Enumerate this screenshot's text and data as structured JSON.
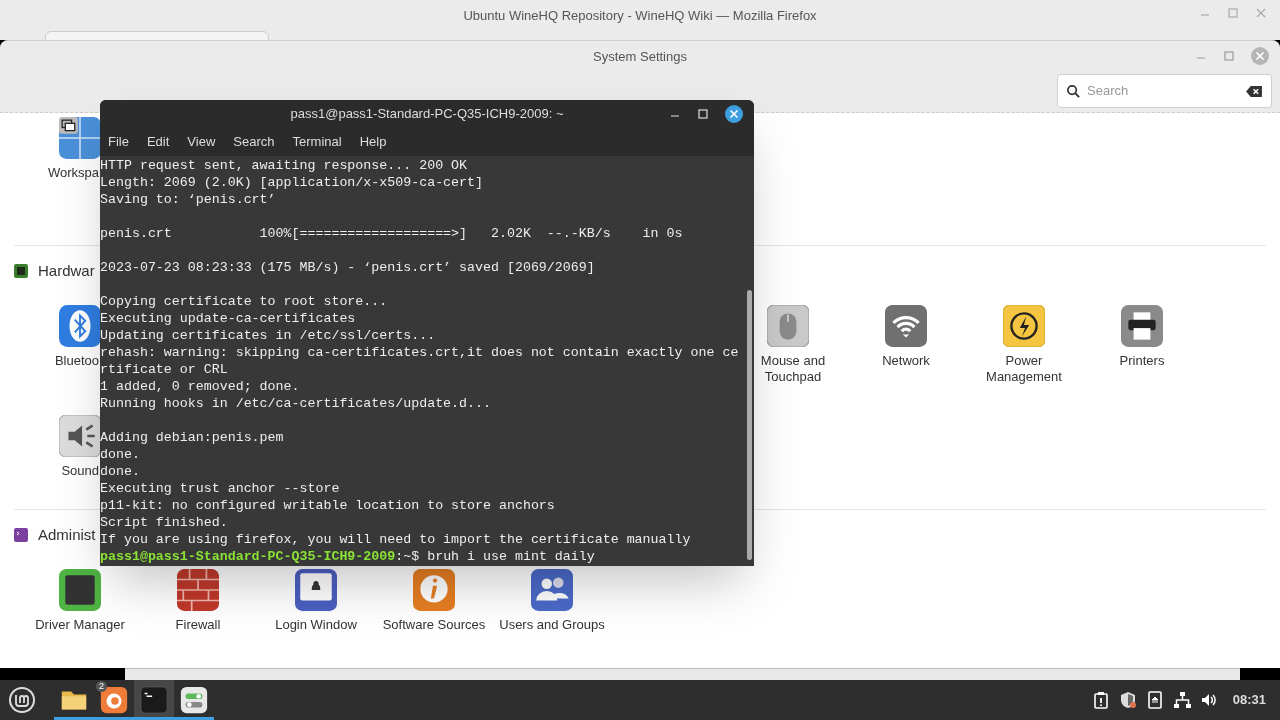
{
  "browser_window": {
    "title": "Ubuntu WineHQ Repository - WineHQ Wiki — Mozilla Firefox"
  },
  "settings_window": {
    "title": "System Settings",
    "search": {
      "placeholder": "Search"
    },
    "sections": [
      {
        "items": [
          {
            "label": "Workspa"
          }
        ]
      },
      {
        "title": "Hardwar",
        "items": [
          {
            "label": "Bluetoo"
          },
          {
            "label": "Mouse and Touchpad"
          },
          {
            "label": "Network"
          },
          {
            "label": "Power Management"
          },
          {
            "label": "Printers"
          },
          {
            "label": "Sound"
          }
        ]
      },
      {
        "title": "Administ",
        "items": [
          {
            "label": "Driver Manager"
          },
          {
            "label": "Firewall"
          },
          {
            "label": "Login Window"
          },
          {
            "label": "Software Sources"
          },
          {
            "label": "Users and Groups"
          }
        ]
      }
    ]
  },
  "terminal": {
    "title": "pass1@pass1-Standard-PC-Q35-ICH9-2009: ~",
    "menu": [
      "File",
      "Edit",
      "View",
      "Search",
      "Terminal",
      "Help"
    ],
    "output_blocks": [
      [
        "HTTP request sent, awaiting response... 200 OK",
        "Length: 2069 (2.0K) [application/x-x509-ca-cert]",
        "Saving to: ‘penis.crt’"
      ],
      [
        "penis.crt           100%[===================>]   2.02K  --.-KB/s    in 0s"
      ],
      [
        "2023-07-23 08:23:33 (175 MB/s) - ‘penis.crt’ saved [2069/2069]"
      ],
      [
        "Copying certificate to root store...",
        "Executing update-ca-certificates",
        "Updating certificates in /etc/ssl/certs...",
        "rehash: warning: skipping ca-certificates.crt,it does not contain exactly one ce",
        "rtificate or CRL",
        "1 added, 0 removed; done.",
        "Running hooks in /etc/ca-certificates/update.d..."
      ],
      [
        "Adding debian:penis.pem",
        "done.",
        "done.",
        "Executing trust anchor --store",
        "p11-kit: no configured writable location to store anchors",
        "Script finished.",
        "If you are using firefox, you will need to import the certificate manually"
      ]
    ],
    "prompt": {
      "user_host": "pass1@pass1-Standard-PC-Q35-ICH9-2009",
      "rest": ":~$ bruh i use mint daily"
    }
  },
  "taskbar": {
    "apps": [
      {
        "running": true,
        "active": false
      },
      {
        "running": true,
        "active": false,
        "badge": "2"
      },
      {
        "running": true,
        "active": true
      },
      {
        "running": true,
        "active": false
      }
    ],
    "clock": "08:31"
  }
}
